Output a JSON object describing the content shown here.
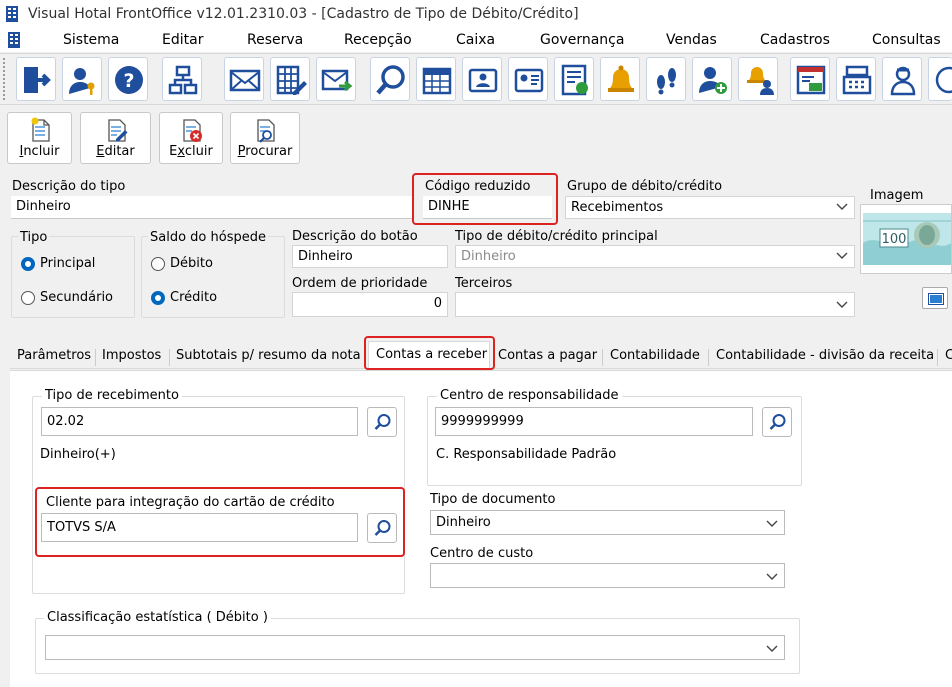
{
  "window": {
    "title": "Visual Hotal FrontOffice v12.01.2310.03 - [Cadastro de Tipo de Débito/Crédito]"
  },
  "menu": [
    "Sistema",
    "Editar",
    "Reserva",
    "Recepção",
    "Caixa",
    "Governança",
    "Vendas",
    "Cadastros",
    "Consultas"
  ],
  "toolbar_icons": [
    "exit-icon",
    "user-key-icon",
    "help-icon",
    "org-chart-icon",
    "mail-icon",
    "spreadsheet-edit-icon",
    "mail-forward-icon",
    "search-icon",
    "calendar-icon",
    "guest-card-icon",
    "guest-card-alt-icon",
    "report-icon",
    "bell-icon",
    "footprints-icon",
    "user-add-icon",
    "bell-people-icon",
    "cash-report-icon",
    "cash-register-icon",
    "maid-icon",
    "more-icon"
  ],
  "actions": {
    "incluir": "Incluir",
    "incluir_key": "I",
    "incluir_rest": "ncluir",
    "editar_key": "E",
    "editar_rest": "ditar",
    "excluir_pre": "E",
    "excluir_key": "x",
    "excluir_rest": "cluir",
    "procurar_key": "P",
    "procurar_rest": "rocurar"
  },
  "form": {
    "descricao_label": "Descrição do tipo",
    "descricao_value": "Dinheiro",
    "codigo_label": "Código reduzido",
    "codigo_value": "DINHE",
    "grupo_label": "Grupo de débito/crédito",
    "grupo_value": "Recebimentos",
    "imagem_label": "Imagem",
    "tipo_label": "Tipo",
    "tipo_options": [
      "Principal",
      "Secundário"
    ],
    "tipo_selected": "Principal",
    "saldo_label": "Saldo do hóspede",
    "saldo_options": [
      "Débito",
      "Crédito"
    ],
    "saldo_selected": "Crédito",
    "desc_botao_label": "Descrição do botão",
    "desc_botao_value": "Dinheiro",
    "tipo_principal_label": "Tipo de débito/crédito principal",
    "tipo_principal_value": "Dinheiro",
    "ordem_label": "Ordem de prioridade",
    "ordem_value": "0",
    "terceiros_label": "Terceiros",
    "terceiros_value": ""
  },
  "tabs": [
    "Parâmetros",
    "Impostos",
    "Subtotais p/ resumo da nota",
    "Contas a receber",
    "Contas a pagar",
    "Contabilidade",
    "Contabilidade - divisão da receita",
    "C"
  ],
  "active_tab": "Contas a receber",
  "contas_receber": {
    "tipo_recebimento_label": "Tipo de recebimento",
    "tipo_recebimento_value": "02.02",
    "tipo_recebimento_desc": "Dinheiro(+)",
    "centro_resp_label": "Centro de responsabilidade",
    "centro_resp_value": "9999999999",
    "centro_resp_desc": "C. Responsabilidade Padrão",
    "cliente_label": "Cliente para integração do cartão de crédito",
    "cliente_value": "TOTVS S/A",
    "tipo_documento_label": "Tipo de documento",
    "tipo_documento_value": "Dinheiro",
    "centro_custo_label": "Centro de custo",
    "centro_custo_value": "",
    "classificacao_label": "Classificação estatística ( Débito )",
    "classificacao_value": ""
  },
  "colors": {
    "accent": "#0067c0",
    "highlight_box": "#dd2222",
    "toolbar_icon": "#1f4e9c"
  }
}
